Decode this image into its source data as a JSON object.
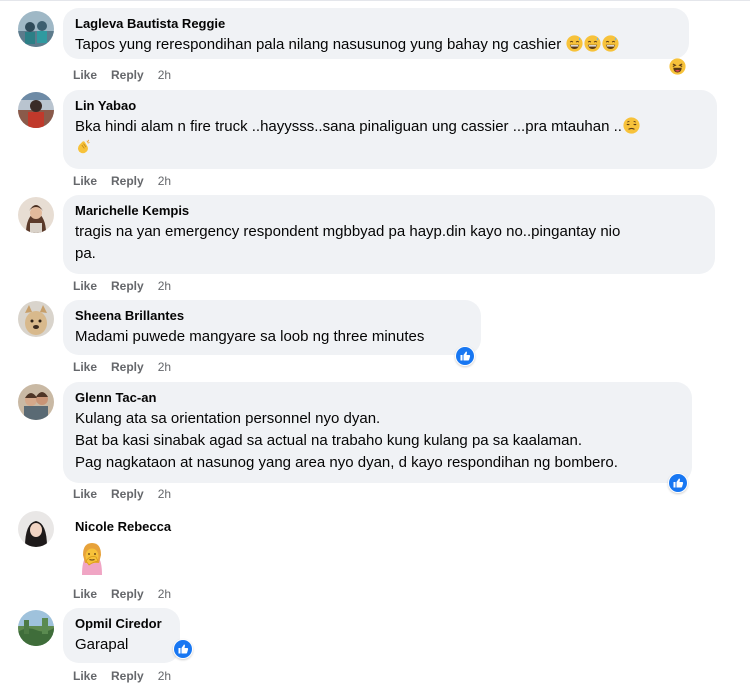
{
  "colors": {
    "bubble": "#f0f2f5",
    "meta": "#65676b",
    "like_blue": "#1877f2"
  },
  "comments": [
    {
      "author": "Lagleva Bautista Reggie",
      "text": "Tapos yung rerespondihan pala nilang nasusunog yung bahay ng cashier",
      "emojis": [
        "grinning-sweat-emoji",
        "grinning-sweat-emoji",
        "grinning-sweat-emoji",
        "laughing-emoji"
      ],
      "like": "Like",
      "reply": "Reply",
      "time": "2h"
    },
    {
      "author": "Lin Yabao",
      "text": "Bka hindi alam n fire truck ..hayysss..sana pinaliguan ung cassier ...pra mtauhan ..",
      "emojis": [
        "downcast-face-emoji",
        "clapping-hands-emoji"
      ],
      "like": "Like",
      "reply": "Reply",
      "time": "2h"
    },
    {
      "author": "Marichelle Kempis",
      "text": "tragis na yan emergency respondent mgbbyad pa hayp.din kayo no..pingantay nio\npa.",
      "like": "Like",
      "reply": "Reply",
      "time": "2h"
    },
    {
      "author": "Sheena Brillantes",
      "text": "Madami puwede mangyare sa loob ng three minutes",
      "reaction": "like-reaction-icon",
      "like": "Like",
      "reply": "Reply",
      "time": "2h"
    },
    {
      "author": "Glenn Tac-an",
      "text": "Kulang ata sa orientation personnel nyo dyan.\nBat ba kasi sinabak agad sa actual na trabaho kung kulang pa sa kaalaman.\nPag nagkataon at nasunog yang area nyo dyan, d kayo respondihan ng bombero.",
      "reaction": "like-reaction-icon",
      "like": "Like",
      "reply": "Reply",
      "time": "2h"
    },
    {
      "author": "Nicole Rebecca",
      "emojis": [
        "face-palm-emoji"
      ],
      "like": "Like",
      "reply": "Reply",
      "time": "2h"
    },
    {
      "author": "Opmil Ciredor",
      "text": "Garapal",
      "reaction": "like-reaction-icon",
      "like": "Like",
      "reply": "Reply",
      "time": "2h"
    }
  ]
}
